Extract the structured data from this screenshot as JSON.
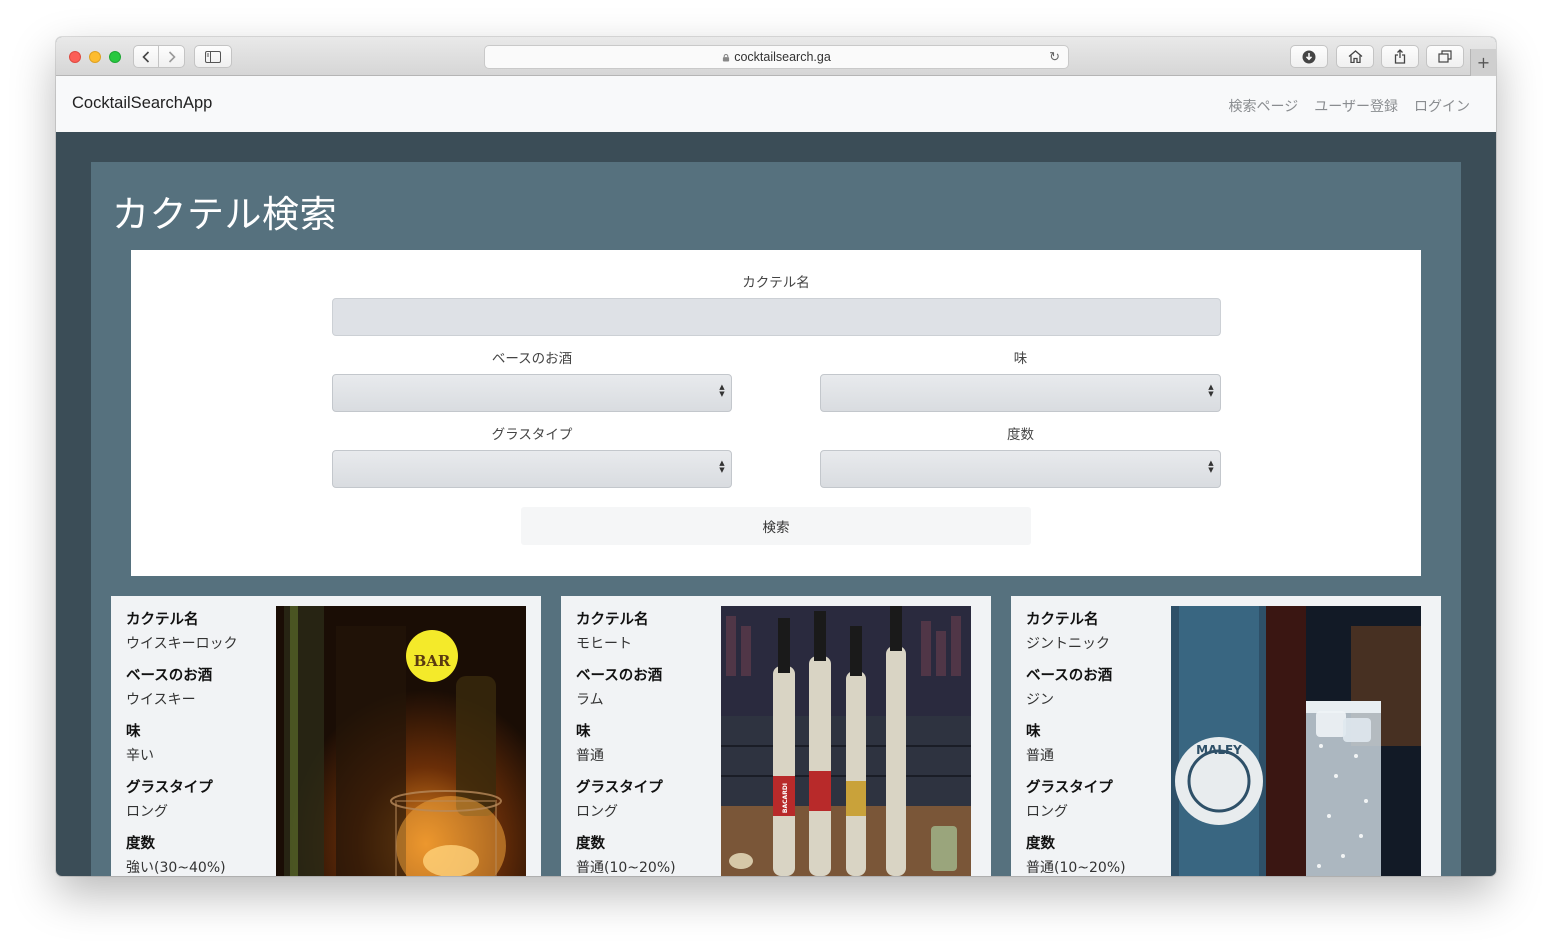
{
  "browser": {
    "url": "cocktailsearch.ga"
  },
  "navbar": {
    "brand": "CocktailSearchApp",
    "links": [
      "検索ページ",
      "ユーザー登録",
      "ログイン"
    ]
  },
  "page": {
    "title": "カクテル検索"
  },
  "form": {
    "name_label": "カクテル名",
    "name_value": "",
    "base_label": "ベースのお酒",
    "base_value": "",
    "taste_label": "味",
    "taste_value": "",
    "glass_label": "グラスタイプ",
    "glass_value": "",
    "strength_label": "度数",
    "strength_value": "",
    "submit_label": "検索"
  },
  "cards": [
    {
      "name_key": "カクテル名",
      "name": "ウイスキーロック",
      "base_key": "ベースのお酒",
      "base": "ウイスキー",
      "taste_key": "味",
      "taste": "辛い",
      "glass_key": "グラスタイプ",
      "glass": "ロング",
      "strength_key": "度数",
      "strength": "強い(30~40%)",
      "photo_sign": "BAR"
    },
    {
      "name_key": "カクテル名",
      "name": "モヒート",
      "base_key": "ベースのお酒",
      "base": "ラム",
      "taste_key": "味",
      "taste": "普通",
      "glass_key": "グラスタイプ",
      "glass": "ロング",
      "strength_key": "度数",
      "strength": "普通(10~20%)",
      "photo_label": "BACARDI"
    },
    {
      "name_key": "カクテル名",
      "name": "ジントニック",
      "base_key": "ベースのお酒",
      "base": "ジン",
      "taste_key": "味",
      "taste": "普通",
      "glass_key": "グラスタイプ",
      "glass": "ロング",
      "strength_key": "度数",
      "strength": "普通(10~20%)",
      "photo_label": "MALFY"
    }
  ],
  "colors": {
    "background": "#3b4d57",
    "jumbotron": "#56717e",
    "navbar": "#f8f9fa",
    "card": "#f1f3f5"
  }
}
